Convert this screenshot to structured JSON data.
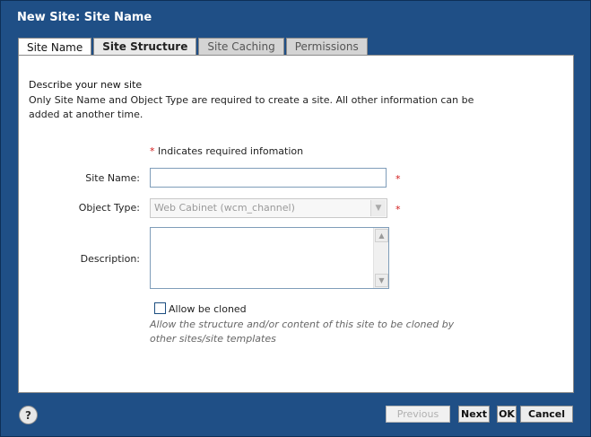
{
  "dialog": {
    "title": "New Site: Site Name"
  },
  "tabs": [
    {
      "label": "Site Name",
      "selected": true
    },
    {
      "label": "Site Structure",
      "selected": false
    },
    {
      "label": "Site Caching",
      "selected": false
    },
    {
      "label": "Permissions",
      "selected": false
    }
  ],
  "intro": {
    "title": "Describe your new site",
    "text": "Only Site Name and Object Type are required to create a site. All other information can be added at another time."
  },
  "required_note": {
    "star": "*",
    "text": "Indicates required infomation"
  },
  "form": {
    "site_name": {
      "label": "Site Name:",
      "value": "",
      "required_star": "*"
    },
    "object_type": {
      "label": "Object Type:",
      "value": "Web Cabinet (wcm_channel)",
      "required_star": "*"
    },
    "description": {
      "label": "Description:",
      "value": ""
    },
    "allow_clone": {
      "label": "Allow be cloned",
      "checked": false,
      "help": "Allow the structure and/or content of this site to be cloned by other sites/site templates"
    }
  },
  "footer": {
    "help_label": "?",
    "previous_label": "Previous",
    "next_label": "Next",
    "ok_label": "OK",
    "cancel_label": "Cancel"
  },
  "colors": {
    "frame": "#1f4f86",
    "required": "#d21a1a"
  }
}
